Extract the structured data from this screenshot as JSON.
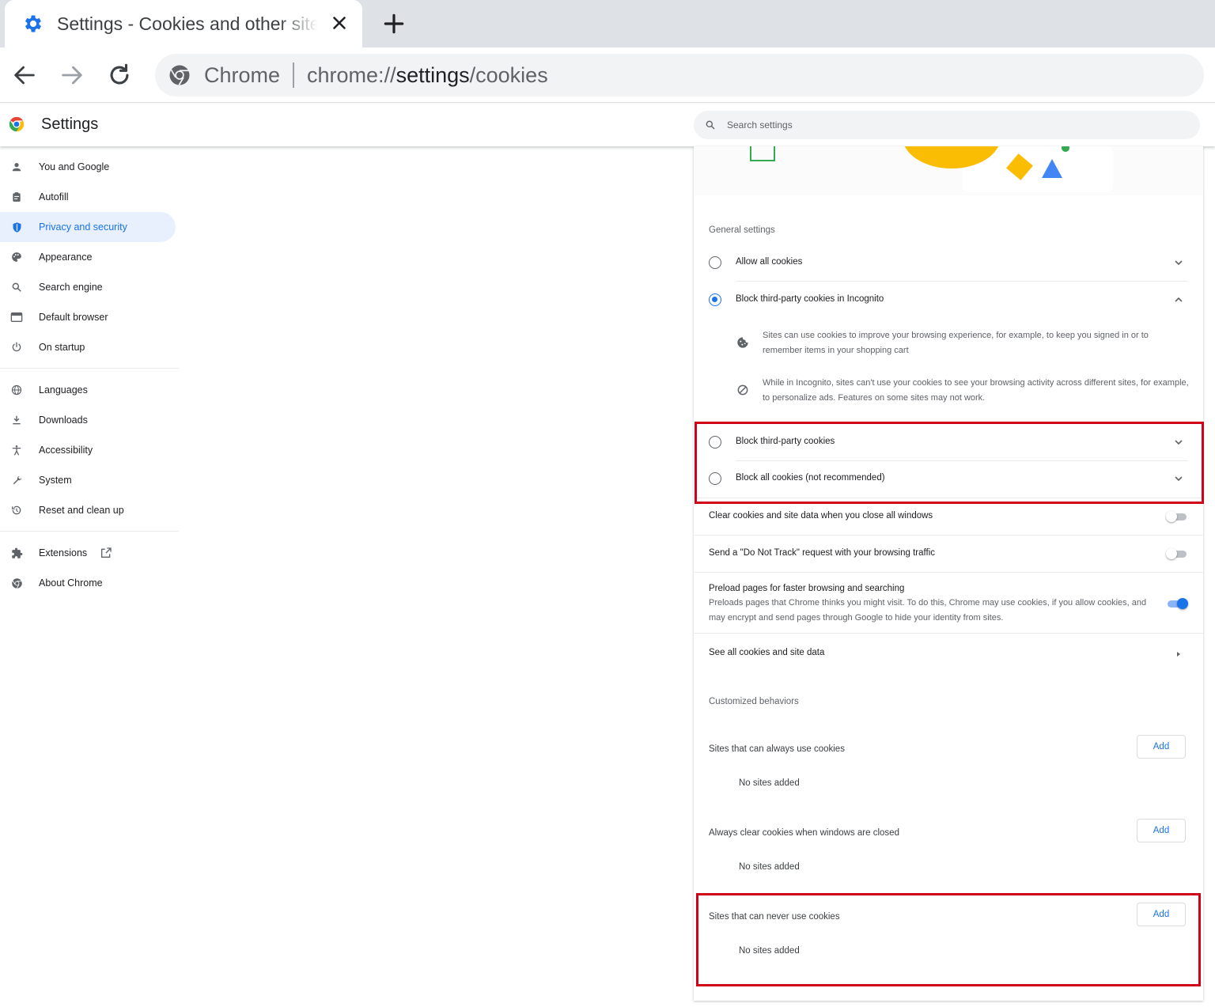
{
  "browser": {
    "tab_title": "Settings - Cookies and other site data",
    "omnibox_origin": "Chrome",
    "url_scheme": "chrome://",
    "url_host": "settings",
    "url_path": "/cookies"
  },
  "header": {
    "title": "Settings",
    "search_placeholder": "Search settings"
  },
  "sidebar": {
    "group1": [
      {
        "label": "You and Google"
      },
      {
        "label": "Autofill"
      },
      {
        "label": "Privacy and security"
      },
      {
        "label": "Appearance"
      },
      {
        "label": "Search engine"
      },
      {
        "label": "Default browser"
      },
      {
        "label": "On startup"
      }
    ],
    "group2": [
      {
        "label": "Languages"
      },
      {
        "label": "Downloads"
      },
      {
        "label": "Accessibility"
      },
      {
        "label": "System"
      },
      {
        "label": "Reset and clean up"
      }
    ],
    "group3": [
      {
        "label": "Extensions"
      },
      {
        "label": "About Chrome"
      }
    ]
  },
  "general": {
    "title": "General settings",
    "allow_all": "Allow all cookies",
    "block_incognito": "Block third-party cookies in Incognito",
    "incognito_desc1": "Sites can use cookies to improve your browsing experience, for example, to keep you signed in or to remember items in your shopping cart",
    "incognito_desc2": "While in Incognito, sites can't use your cookies to see your browsing activity across different sites, for example, to personalize ads. Features on some sites may not work.",
    "block_third_party": "Block third-party cookies",
    "block_all": "Block all cookies (not recommended)",
    "selected_option": "Block third-party cookies in Incognito"
  },
  "toggles": {
    "clear_on_close": "Clear cookies and site data when you close all windows",
    "do_not_track": "Send a \"Do Not Track\" request with your browsing traffic",
    "preload_title": "Preload pages for faster browsing and searching",
    "preload_desc": "Preloads pages that Chrome thinks you might visit. To do this, Chrome may use cookies, if you allow cookies, and may encrypt and send pages through Google to hide your identity from sites.",
    "clear_on_close_state": false,
    "do_not_track_state": false,
    "preload_state": true
  },
  "see_all": "See all cookies and site data",
  "customized": {
    "title": "Customized behaviors",
    "lists": [
      {
        "title": "Sites that can always use cookies",
        "add_label": "Add",
        "empty": "No sites added"
      },
      {
        "title": "Always clear cookies when windows are closed",
        "add_label": "Add",
        "empty": "No sites added"
      },
      {
        "title": "Sites that can never use cookies",
        "add_label": "Add",
        "empty": "No sites added"
      }
    ]
  },
  "colors": {
    "accent": "#1a73e8",
    "highlight": "#d0021b"
  }
}
